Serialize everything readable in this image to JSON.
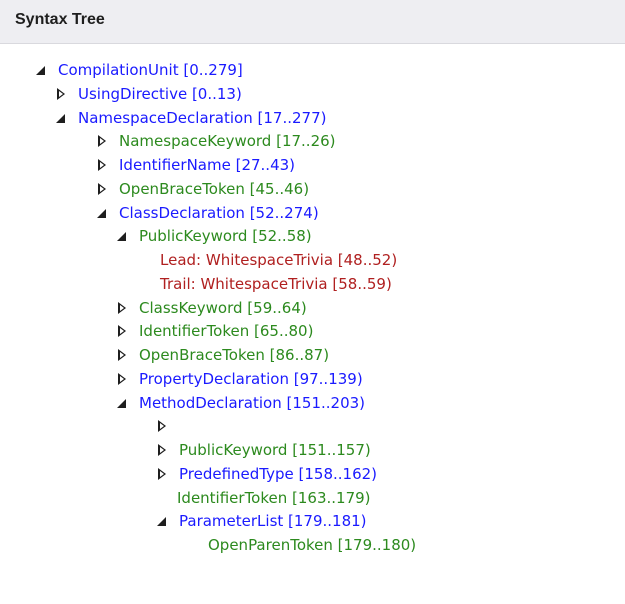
{
  "panel": {
    "title": "Syntax Tree"
  },
  "tree": {
    "rows": [
      {
        "text": "CompilationUnit [0..279]",
        "kind": "node",
        "toggle": "expanded"
      },
      {
        "text": "UsingDirective [0..13)",
        "kind": "node",
        "toggle": "collapsed"
      },
      {
        "text": "NamespaceDeclaration [17..277)",
        "kind": "node",
        "toggle": "expanded"
      },
      {
        "text": "NamespaceKeyword [17..26)",
        "kind": "token",
        "toggle": "collapsed"
      },
      {
        "text": "IdentifierName [27..43)",
        "kind": "node",
        "toggle": "collapsed"
      },
      {
        "text": "OpenBraceToken [45..46)",
        "kind": "token",
        "toggle": "collapsed"
      },
      {
        "text": "ClassDeclaration [52..274)",
        "kind": "node",
        "toggle": "expanded"
      },
      {
        "text": "PublicKeyword [52..58)",
        "kind": "token",
        "toggle": "expanded"
      },
      {
        "text": "Lead: WhitespaceTrivia [48..52)",
        "kind": "trivia",
        "toggle": "none"
      },
      {
        "text": "Trail: WhitespaceTrivia [58..59)",
        "kind": "trivia",
        "toggle": "none"
      },
      {
        "text": "ClassKeyword [59..64)",
        "kind": "token",
        "toggle": "collapsed"
      },
      {
        "text": "IdentifierToken [65..80)",
        "kind": "token",
        "toggle": "collapsed"
      },
      {
        "text": "OpenBraceToken [86..87)",
        "kind": "token",
        "toggle": "collapsed"
      },
      {
        "text": "PropertyDeclaration [97..139)",
        "kind": "node",
        "toggle": "collapsed"
      },
      {
        "text": "MethodDeclaration [151..203)",
        "kind": "node",
        "toggle": "expanded"
      },
      {
        "text": "",
        "kind": "node",
        "toggle": "collapsed"
      },
      {
        "text": "PublicKeyword [151..157)",
        "kind": "token",
        "toggle": "collapsed"
      },
      {
        "text": "PredefinedType [158..162)",
        "kind": "node",
        "toggle": "collapsed"
      },
      {
        "text": "IdentifierToken [163..179)",
        "kind": "token",
        "toggle": "none"
      },
      {
        "text": "ParameterList [179..181)",
        "kind": "node",
        "toggle": "expanded"
      },
      {
        "text": "OpenParenToken [179..180)",
        "kind": "token",
        "toggle": "none"
      }
    ]
  }
}
